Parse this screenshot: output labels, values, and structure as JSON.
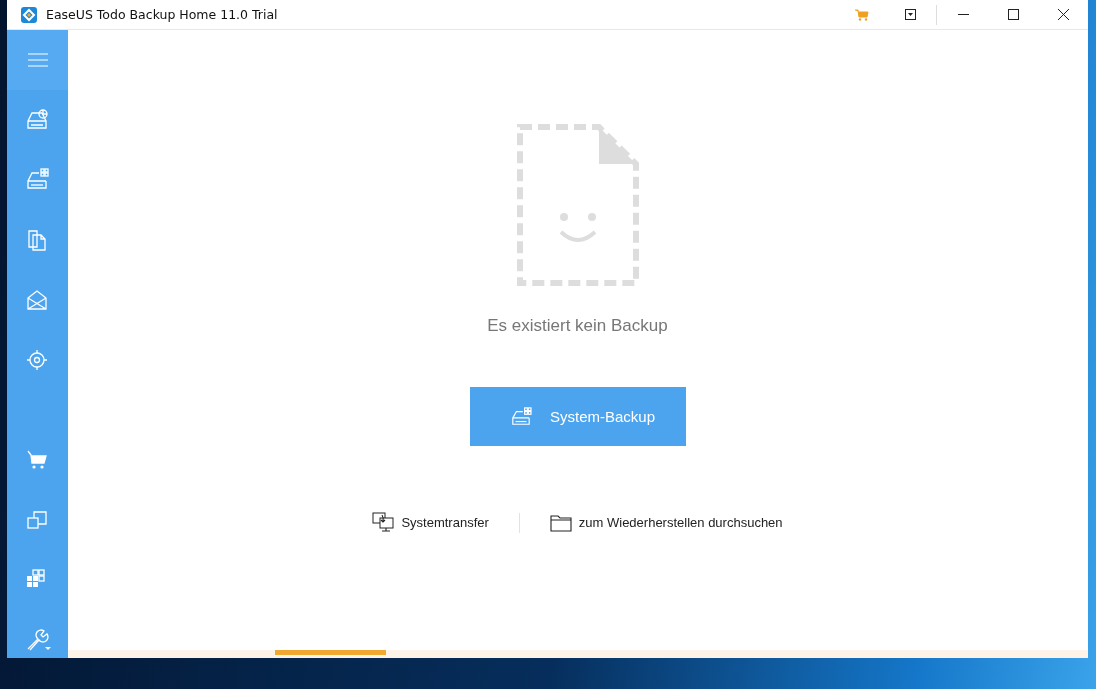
{
  "window": {
    "title": "EaseUS Todo Backup Home 11.0 Trial"
  },
  "sidebar": {
    "top": [
      {
        "kind": "disk-chart"
      },
      {
        "kind": "disk-grid"
      },
      {
        "kind": "files"
      },
      {
        "kind": "mail"
      },
      {
        "kind": "target"
      }
    ],
    "bottom": [
      {
        "kind": "cart"
      },
      {
        "kind": "clone"
      },
      {
        "kind": "blocks"
      },
      {
        "kind": "tools"
      }
    ]
  },
  "empty_state": {
    "message": "Es existiert kein Backup",
    "button": "System-Backup"
  },
  "links": [
    {
      "kind": "transfer",
      "label": "Systemtransfer"
    },
    {
      "kind": "folder",
      "label": "zum Wiederherstellen durchsuchen"
    }
  ]
}
